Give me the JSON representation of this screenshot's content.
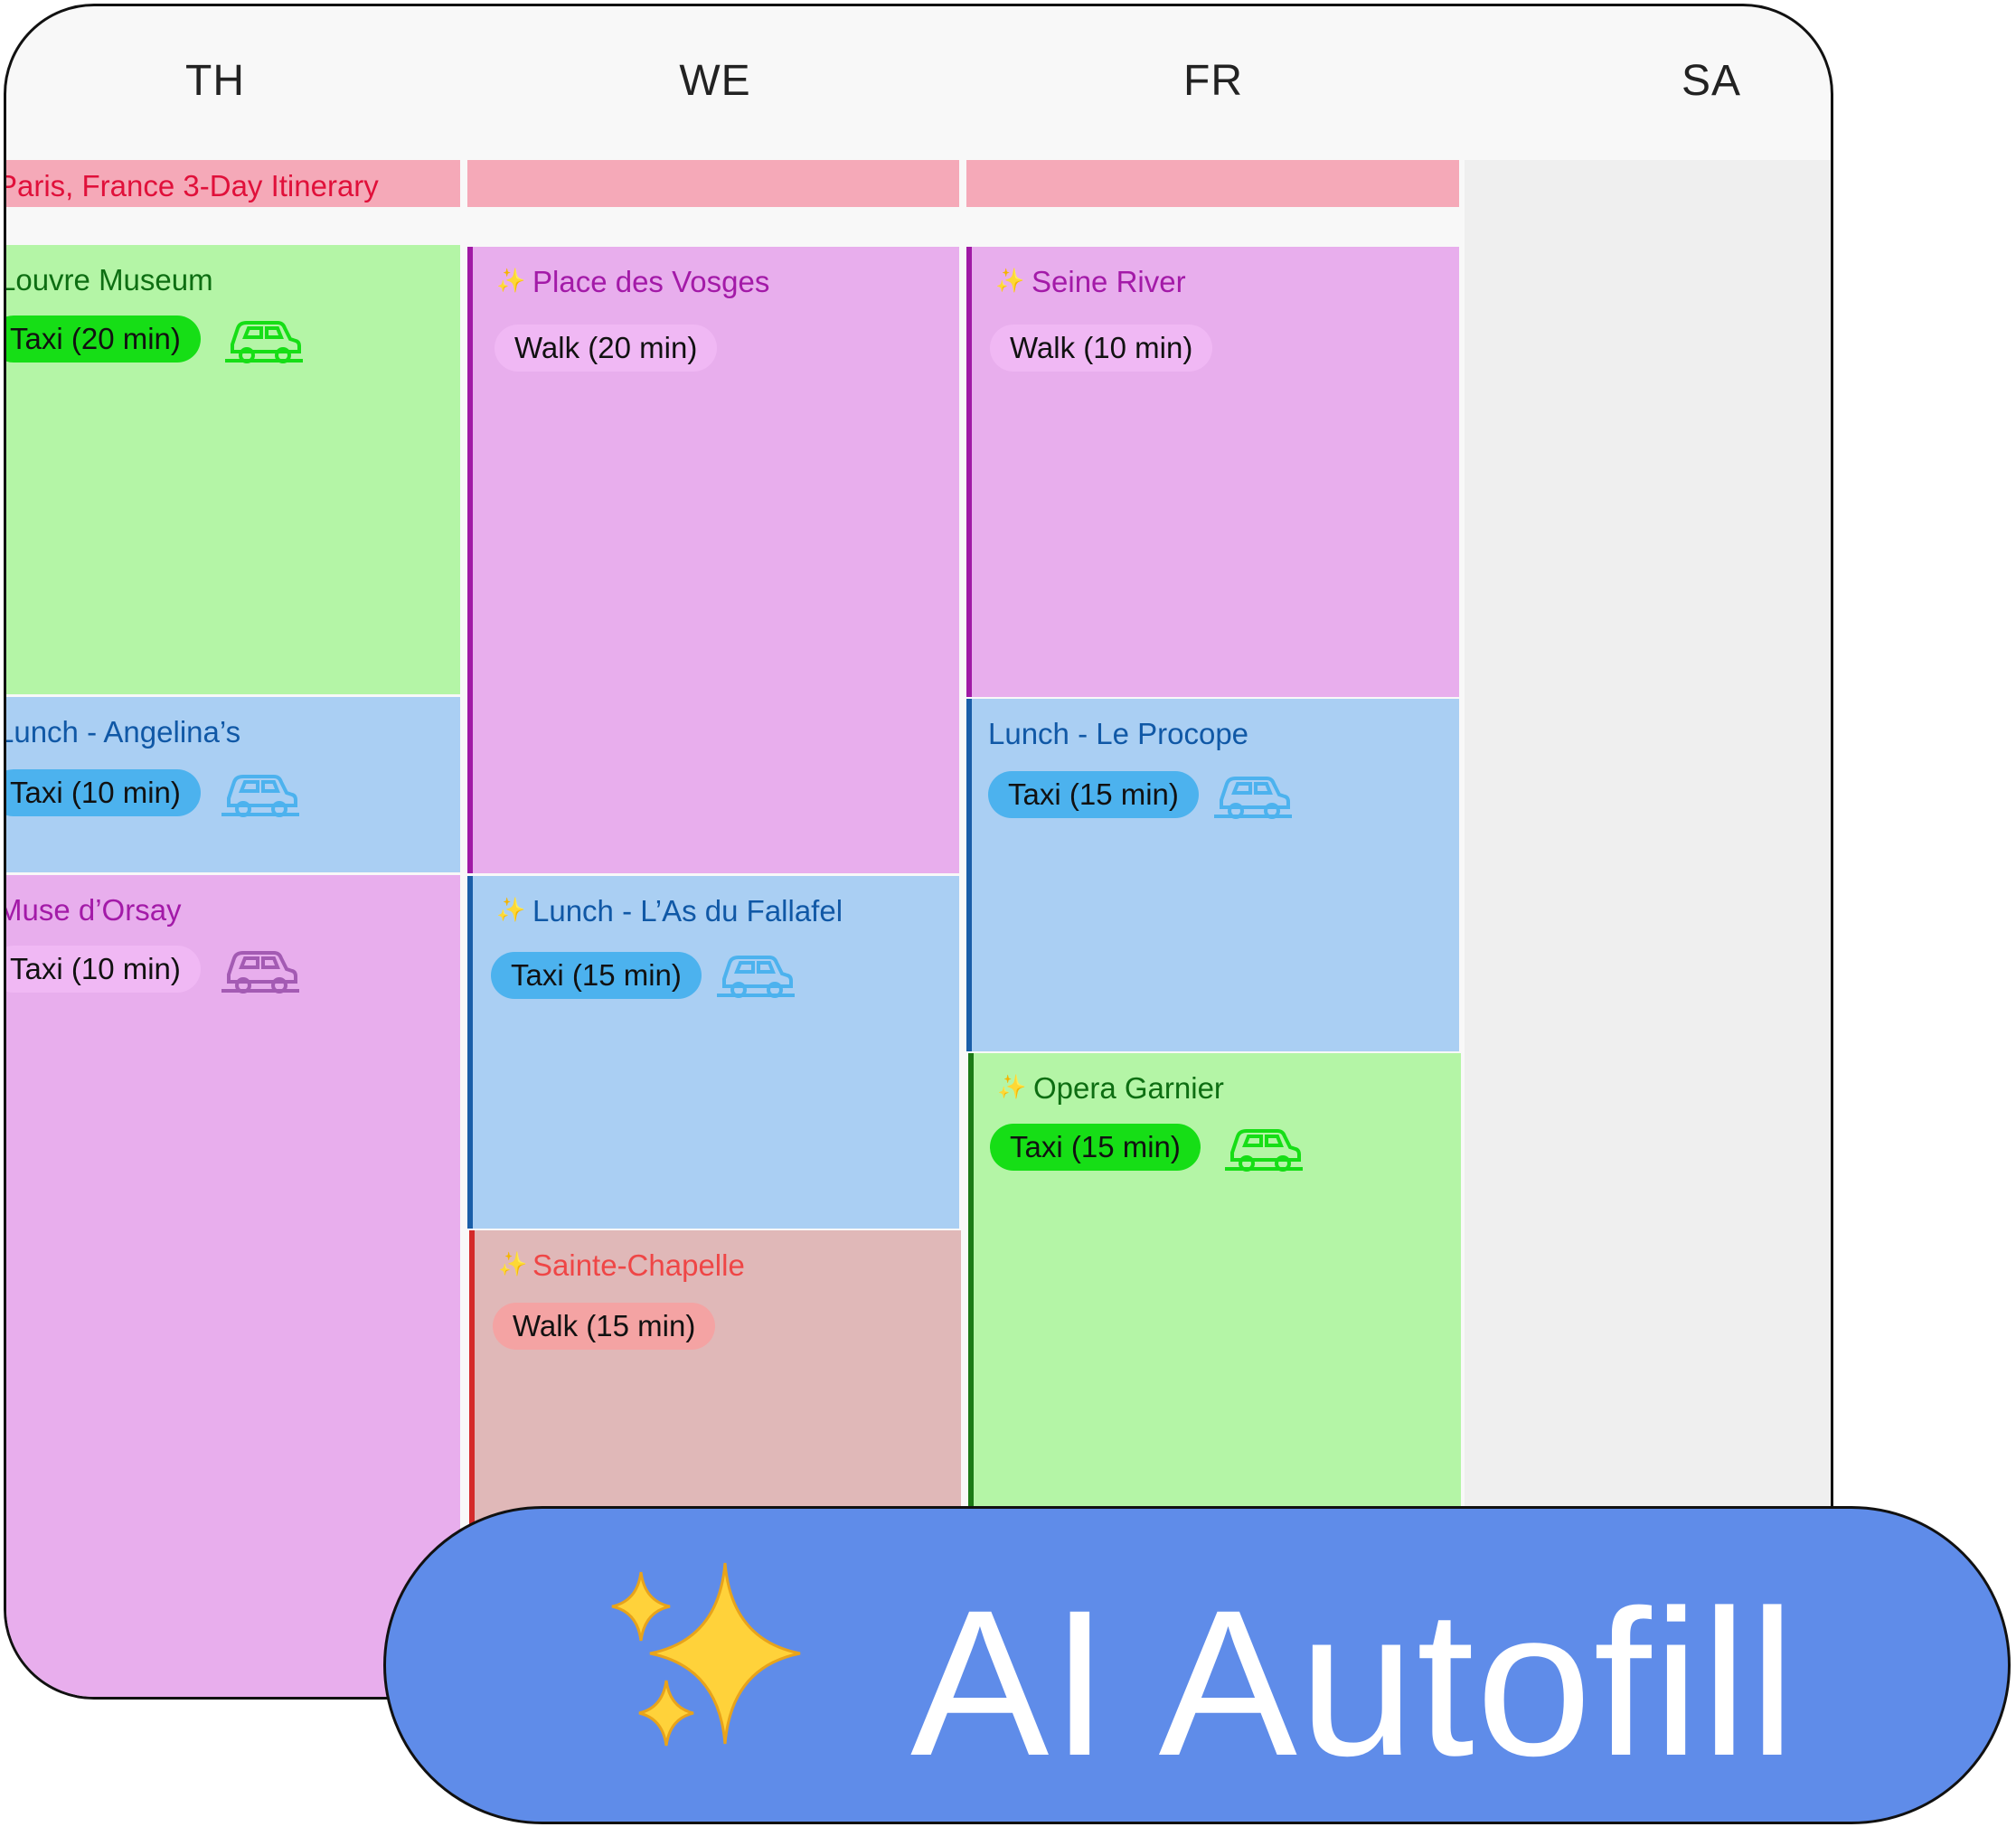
{
  "days": [
    "TH",
    "WE",
    "FR",
    "SA"
  ],
  "banner": "Paris, France 3-Day Itinerary",
  "events": {
    "louvre": {
      "title": "Louvre Museum",
      "transport": "Taxi (20 min)"
    },
    "lunch_angelina": {
      "title": "Lunch - Angelina’s",
      "transport": "Taxi (10 min)"
    },
    "orsay": {
      "title": "Muse d’Orsay",
      "transport": "Taxi (10 min)"
    },
    "vosges": {
      "title": "Place des Vosges",
      "transport": "Walk (20 min)"
    },
    "lunch_fallafel": {
      "title": "Lunch - L’As du Fallafel",
      "transport": "Taxi (15 min)"
    },
    "chapelle": {
      "title": "Sainte-Chapelle",
      "transport": "Walk (15 min)"
    },
    "seine": {
      "title": "Seine River",
      "transport": "Walk (10 min)"
    },
    "lunch_procope": {
      "title": "Lunch - Le Procope",
      "transport": "Taxi (15 min)"
    },
    "opera": {
      "title": "Opera Garnier",
      "transport": "Taxi (15 min)"
    }
  },
  "cta": {
    "label": "AI Autofill"
  },
  "icons": {
    "sparkle": "sparkle-icon",
    "car": "car-icon"
  },
  "colors": {
    "green": "#b4f5a6",
    "blue": "#aacff3",
    "pink": "#e8aeed",
    "rose": "#e0b8b8",
    "banner": "#f5a9b8",
    "cta": "#5f8ce9"
  }
}
